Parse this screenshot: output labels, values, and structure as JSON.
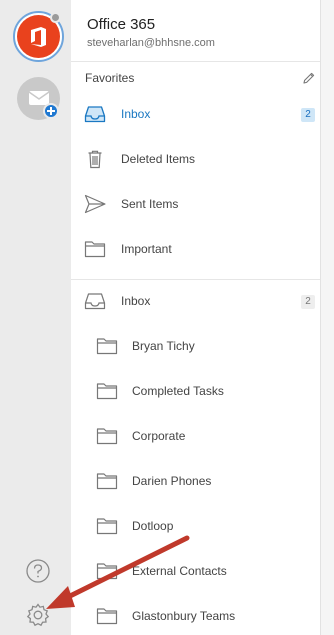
{
  "account": {
    "name": "Office 365",
    "email": "steveharlan@bhhsne.com"
  },
  "favorites": {
    "title": "Favorites",
    "items": [
      {
        "label": "Inbox",
        "count": "2",
        "icon": "inbox-icon",
        "active": true
      },
      {
        "label": "Deleted Items",
        "icon": "trash-icon"
      },
      {
        "label": "Sent Items",
        "icon": "send-icon"
      },
      {
        "label": "Important",
        "icon": "folder-icon"
      }
    ]
  },
  "folders": {
    "inbox": {
      "label": "Inbox",
      "count": "2"
    },
    "items": [
      {
        "label": "Bryan Tichy"
      },
      {
        "label": "Completed Tasks"
      },
      {
        "label": "Corporate"
      },
      {
        "label": "Darien Phones"
      },
      {
        "label": "Dotloop"
      },
      {
        "label": "External Contacts"
      },
      {
        "label": "Glastonbury Teams"
      }
    ]
  },
  "colors": {
    "accent": "#1a78c2",
    "office_brand": "#e9421d",
    "annotation_arrow": "#c0392b"
  }
}
